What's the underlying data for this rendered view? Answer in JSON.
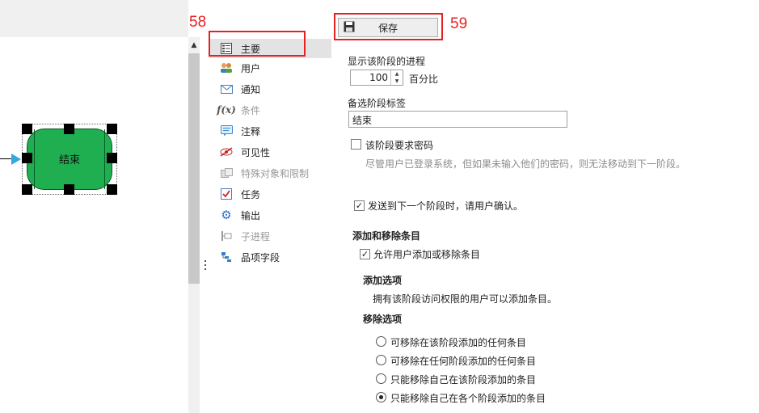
{
  "canvas": {
    "shape_label": "结束"
  },
  "callouts": {
    "first": "58",
    "second": "59"
  },
  "nav": {
    "items": [
      {
        "label": "主要",
        "icon": "list-properties-icon"
      },
      {
        "label": "用户",
        "icon": "users-icon"
      },
      {
        "label": "通知",
        "icon": "envelope-icon"
      },
      {
        "label": "条件",
        "icon": "function-icon"
      },
      {
        "label": "注释",
        "icon": "comment-icon"
      },
      {
        "label": "可见性",
        "icon": "visibility-eye-icon"
      },
      {
        "label": "特殊对象和限制",
        "icon": "special-objects-icon"
      },
      {
        "label": "任务",
        "icon": "task-checklist-icon"
      },
      {
        "label": "输出",
        "icon": "gear-output-icon"
      },
      {
        "label": "子进程",
        "icon": "subprocess-icon"
      },
      {
        "label": "品项字段",
        "icon": "item-fields-icon"
      }
    ]
  },
  "toolbar": {
    "save_label": "保存"
  },
  "form": {
    "progress_label": "显示该阶段的进程",
    "progress_value": "100",
    "progress_unit": "百分比",
    "alt_label_title": "备选阶段标签",
    "alt_label_value": "结束",
    "password_label": "该阶段要求密码",
    "password_hint": "尽管用户已登录系统，但如果未输入他们的密码，则无法移动到下一阶段。",
    "confirm_label": "发送到下一个阶段时，请用户确认。",
    "add_remove_title": "添加和移除条目",
    "allow_add_remove_label": "允许用户添加或移除条目",
    "add_options_title": "添加选项",
    "add_options_text": "拥有该阶段访问权限的用户可以添加条目。",
    "remove_options_title": "移除选项",
    "remove_options": [
      {
        "label": "可移除在该阶段添加的任何条目",
        "selected": false
      },
      {
        "label": "可移除在任何阶段添加的任何条目",
        "selected": false
      },
      {
        "label": "只能移除自己在该阶段添加的条目",
        "selected": false
      },
      {
        "label": "只能移除自己在各个阶段添加的条目",
        "selected": true
      }
    ]
  },
  "colors": {
    "shape_fill": "#1fae50",
    "callout": "#e52222",
    "selected_nav": "#e3e3e3"
  }
}
